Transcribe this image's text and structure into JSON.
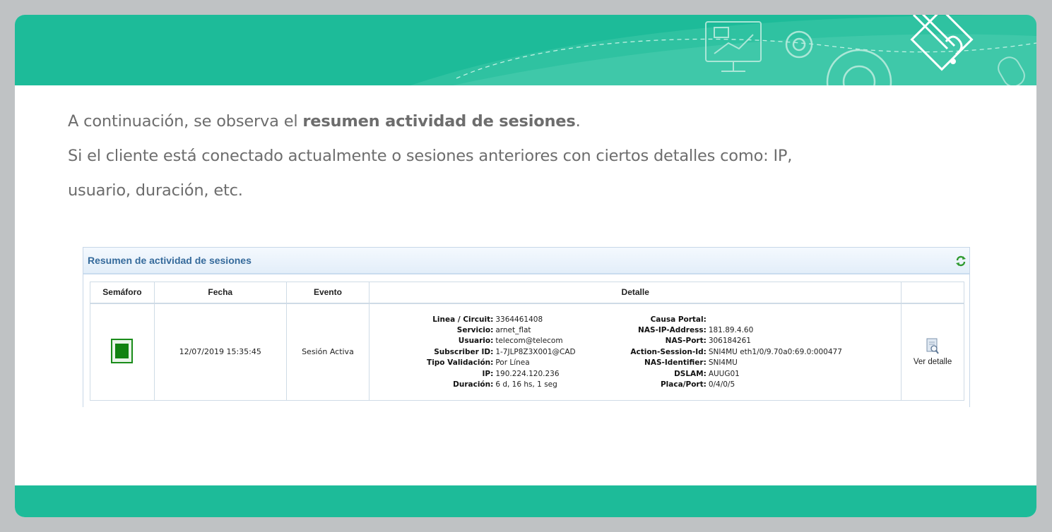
{
  "intro": {
    "line1_prefix": "A continuación, se observa el ",
    "line1_bold": "resumen actividad de sesiones",
    "line1_suffix": ".",
    "line2": "Si el cliente está conectado actualmente o sesiones anteriores con ciertos detalles como: IP,",
    "line3": "usuario, duración, etc."
  },
  "panel": {
    "title": "Resumen de actividad de sesiones",
    "columns": [
      "Semáforo",
      "Fecha",
      "Evento",
      "Detalle",
      ""
    ],
    "row": {
      "semaforo_color": "#118211",
      "fecha": "12/07/2019 15:35:45",
      "evento": "Sesión Activa",
      "detail_left": [
        {
          "k": "Linea / Circuit:",
          "v": "3364461408"
        },
        {
          "k": "Servicio:",
          "v": "arnet_flat"
        },
        {
          "k": "Usuario:",
          "v": "telecom@telecom"
        },
        {
          "k": "Subscriber ID:",
          "v": "1-7JLP8Z3X001@CAD"
        },
        {
          "k": "Tipo Validación:",
          "v": "Por Línea"
        },
        {
          "k": "IP:",
          "v": "190.224.120.236"
        },
        {
          "k": "Duración:",
          "v": "6 d, 16 hs, 1 seg"
        }
      ],
      "detail_right": [
        {
          "k": "Causa Portal:",
          "v": ""
        },
        {
          "k": "NAS-IP-Address:",
          "v": "181.89.4.60"
        },
        {
          "k": "NAS-Port:",
          "v": "306184261"
        },
        {
          "k": "Action-Session-Id:",
          "v": "SNI4MU eth1/0/9.70a0:69.0:000477"
        },
        {
          "k": "NAS-Identifier:",
          "v": "SNI4MU"
        },
        {
          "k": "DSLAM:",
          "v": "AUUG01"
        },
        {
          "k": "Placa/Port:",
          "v": "0/4/0/5"
        }
      ],
      "action_label": "Ver detalle"
    }
  },
  "colors": {
    "brand": "#1dbb99",
    "panel_title": "#356a9b"
  }
}
